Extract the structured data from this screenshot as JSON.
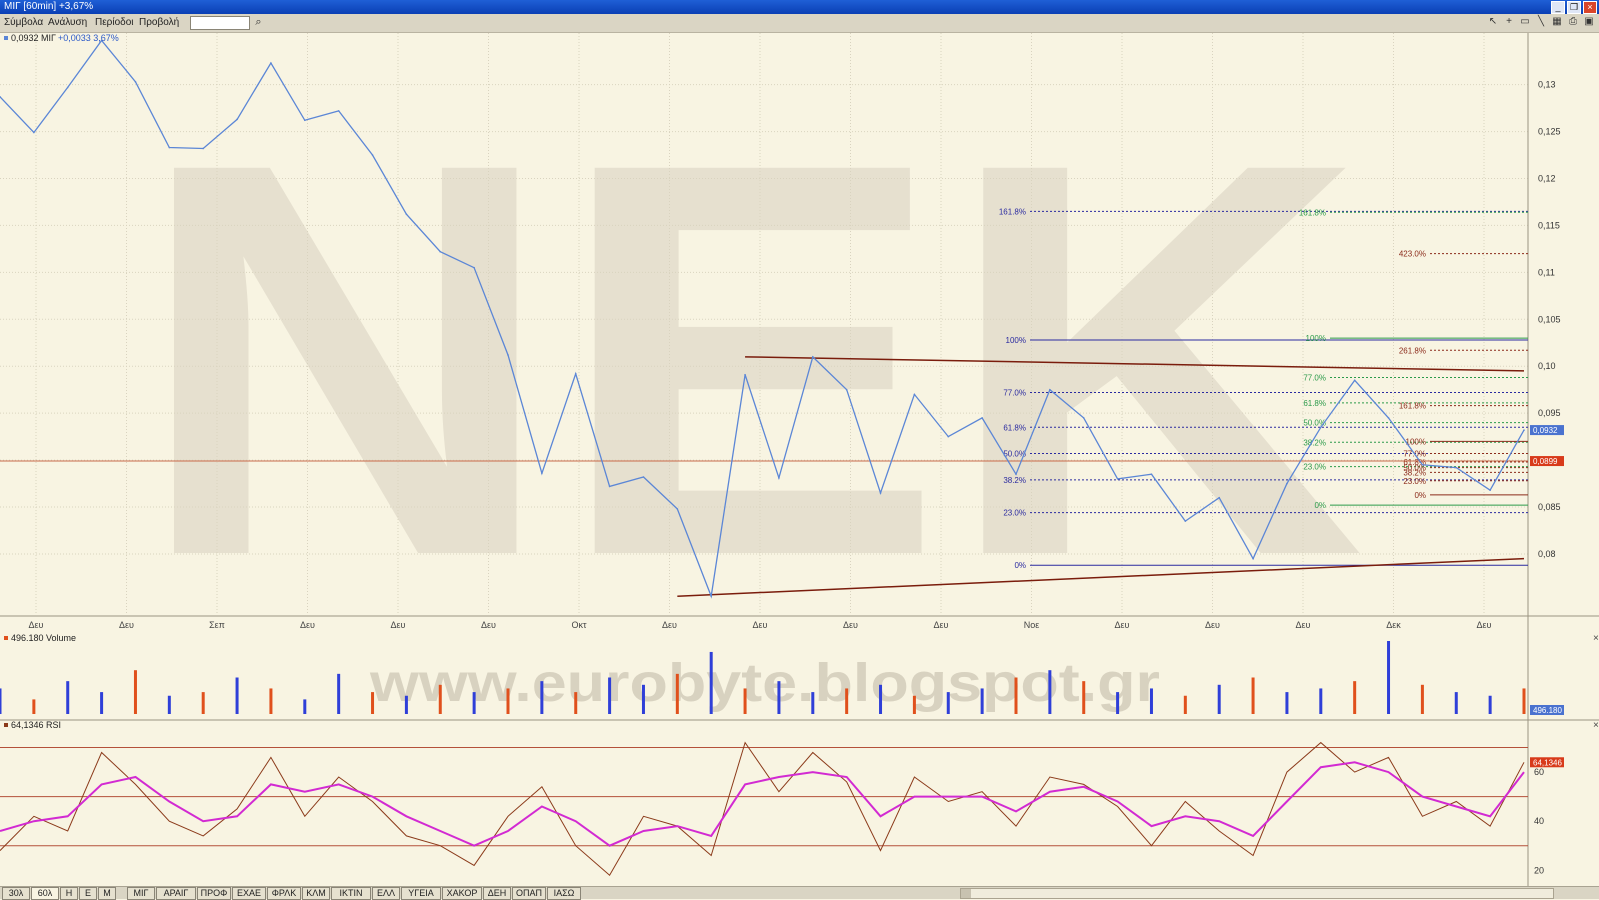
{
  "window": {
    "title": "ΜΙΓ [60min] +3,67%"
  },
  "menu": [
    "Σύμβολα",
    "Ανάλυση",
    "Περίοδοι",
    "Προβολή"
  ],
  "search": {
    "placeholder": ""
  },
  "colors": {
    "background": "#f8f4e2",
    "price_line": "#5b86d6",
    "trend_line": "#7a1c0c",
    "fib_a": "#2a2aa0",
    "fib_b": "#2b9a4a",
    "fib_c": "#8b2a1a",
    "rsi": "#8b3a1a",
    "rsi_ma": "#d22ad2",
    "vol_up": "#2f3fd8",
    "vol_down": "#e0501c"
  },
  "watermarks": {
    "main": "NEK",
    "site": "www.eurobyte.blogspot.gr"
  },
  "chart_data": [
    {
      "type": "line",
      "legend": "0,0932 ΜΙΓ",
      "change": "+0,0033 3,67%",
      "ylim": [
        0.0735,
        0.1355
      ],
      "yticks": [
        "0,13",
        "0,125",
        "0,12",
        "0,115",
        "0,11",
        "0,105",
        "0,10",
        "0,095",
        "0,09",
        "0,085",
        "0,08"
      ],
      "ytick_values": [
        0.13,
        0.125,
        0.12,
        0.115,
        0.11,
        0.105,
        0.1,
        0.095,
        0.09,
        0.085,
        0.08
      ],
      "xticks": [
        "Δευ",
        "Δευ",
        "Σεπ",
        "Δευ",
        "Δευ",
        "Δευ",
        "Οκτ",
        "Δευ",
        "Δευ",
        "Δευ",
        "Δευ",
        "Νοε",
        "Δευ",
        "Δευ",
        "Δευ",
        "Δεκ",
        "Δευ"
      ],
      "x": [
        0,
        4,
        8,
        12,
        16,
        20,
        24,
        28,
        32,
        36,
        40,
        44,
        48,
        52,
        56,
        60,
        64,
        68,
        72,
        76,
        80,
        84,
        88,
        92,
        96,
        100,
        104,
        108,
        112,
        116,
        120,
        124,
        128,
        132,
        136,
        140,
        144,
        148,
        152,
        156,
        160,
        164,
        168,
        172,
        176,
        180
      ],
      "close": [
        0.1287,
        0.1249,
        0.1297,
        0.1347,
        0.1303,
        0.1233,
        0.1232,
        0.1263,
        0.1323,
        0.1262,
        0.1272,
        0.1225,
        0.1162,
        0.1122,
        0.1105,
        0.1012,
        0.0886,
        0.0992,
        0.0872,
        0.0882,
        0.0848,
        0.0755,
        0.0991,
        0.0881,
        0.101,
        0.0975,
        0.0865,
        0.097,
        0.0925,
        0.0945,
        0.0885,
        0.0975,
        0.0945,
        0.088,
        0.0885,
        0.0835,
        0.086,
        0.0795,
        0.0875,
        0.0935,
        0.0985,
        0.0945,
        0.0895,
        0.0892,
        0.0868,
        0.0932
      ],
      "last": "0,0932",
      "ref_level": {
        "value": 0.0899,
        "label": "0,0899"
      },
      "trendlines": [
        {
          "from": [
            80,
            0.0755
          ],
          "to": [
            180,
            0.0795
          ]
        },
        {
          "from": [
            88,
            0.101
          ],
          "to": [
            180,
            0.0995
          ]
        }
      ],
      "fib_sets": [
        {
          "name": "A",
          "levels": [
            "0%",
            "23.0%",
            "38.2%",
            "50.0%",
            "61.8%",
            "77.0%",
            "100%",
            "161.8%"
          ],
          "values": [
            0.0788,
            0.0844,
            0.0879,
            0.0907,
            0.0935,
            0.0972,
            0.1028,
            0.1165
          ]
        },
        {
          "name": "B",
          "levels": [
            "0%",
            "23.0%",
            "38.2%",
            "50.0%",
            "61.8%",
            "77.0%",
            "100%",
            "161.8%"
          ],
          "values": [
            0.0852,
            0.0893,
            0.0919,
            0.094,
            0.0961,
            0.0988,
            0.103,
            0.1164
          ]
        },
        {
          "name": "C",
          "levels": [
            "0%",
            "23.0%",
            "38.2%",
            "50.0%",
            "61.8%",
            "77.0%",
            "100%",
            "161.8%",
            "261.8%",
            "423.0%"
          ],
          "values": [
            0.0863,
            0.0878,
            0.0887,
            0.0892,
            0.0898,
            0.0907,
            0.092,
            0.0958,
            0.1017,
            0.112
          ]
        }
      ]
    },
    {
      "type": "bar",
      "legend": "496.180 Volume",
      "last": "496.180",
      "x": [
        0,
        4,
        8,
        12,
        16,
        20,
        24,
        28,
        32,
        36,
        40,
        44,
        48,
        52,
        56,
        60,
        64,
        68,
        72,
        76,
        80,
        84,
        88,
        92,
        96,
        100,
        104,
        108,
        112,
        116,
        120,
        124,
        128,
        132,
        136,
        140,
        144,
        148,
        152,
        156,
        160,
        164,
        168,
        172,
        176,
        180
      ],
      "values": [
        0.35,
        0.2,
        0.45,
        0.3,
        0.6,
        0.25,
        0.3,
        0.5,
        0.35,
        0.2,
        0.55,
        0.3,
        0.25,
        0.4,
        0.3,
        0.35,
        0.45,
        0.3,
        0.5,
        0.4,
        0.55,
        0.85,
        0.35,
        0.45,
        0.3,
        0.35,
        0.4,
        0.25,
        0.3,
        0.35,
        0.5,
        0.6,
        0.45,
        0.3,
        0.35,
        0.25,
        0.4,
        0.5,
        0.3,
        0.35,
        0.45,
        1.0,
        0.4,
        0.3,
        0.25,
        0.35
      ],
      "up": [
        true,
        false,
        true,
        true,
        false,
        true,
        false,
        true,
        false,
        true,
        true,
        false,
        true,
        false,
        true,
        false,
        true,
        false,
        true,
        true,
        false,
        true,
        false,
        true,
        true,
        false,
        true,
        false,
        true,
        true,
        false,
        true,
        false,
        true,
        true,
        false,
        true,
        false,
        true,
        true,
        false,
        true,
        false,
        true,
        true,
        false
      ]
    },
    {
      "type": "line",
      "legend": "64,1346 RSI",
      "last": "64,1346",
      "ylim": [
        14,
        80
      ],
      "yticks": [
        "60",
        "40",
        "20"
      ],
      "ytick_values": [
        60,
        40,
        20
      ],
      "levels": [
        70,
        50,
        30
      ],
      "x": [
        0,
        4,
        8,
        12,
        16,
        20,
        24,
        28,
        32,
        36,
        40,
        44,
        48,
        52,
        56,
        60,
        64,
        68,
        72,
        76,
        80,
        84,
        88,
        92,
        96,
        100,
        104,
        108,
        112,
        116,
        120,
        124,
        128,
        132,
        136,
        140,
        144,
        148,
        152,
        156,
        160,
        164,
        168,
        172,
        176,
        180
      ],
      "rsi": [
        28,
        42,
        36,
        68,
        55,
        40,
        34,
        45,
        66,
        42,
        58,
        48,
        34,
        30,
        22,
        42,
        54,
        30,
        18,
        42,
        38,
        26,
        72,
        52,
        68,
        56,
        28,
        58,
        48,
        52,
        38,
        58,
        55,
        46,
        30,
        48,
        36,
        26,
        60,
        72,
        60,
        66,
        42,
        48,
        38,
        64
      ],
      "ma": [
        36,
        40,
        42,
        55,
        58,
        48,
        40,
        42,
        55,
        52,
        55,
        50,
        42,
        36,
        30,
        36,
        46,
        40,
        30,
        36,
        38,
        34,
        55,
        58,
        60,
        58,
        42,
        50,
        50,
        50,
        44,
        52,
        54,
        48,
        38,
        42,
        40,
        34,
        48,
        62,
        64,
        60,
        50,
        46,
        42,
        60
      ]
    }
  ],
  "bottom_tabs": [
    "30λ",
    "60λ",
    "Η",
    "Ε",
    "Μ",
    "ΜΙΓ",
    "ΑΡΑΙΓ",
    "ΠΡΟΦ",
    "ΕΧΑΕ",
    "ΦΡΛΚ",
    "ΚΛΜ",
    "ΙΚΤΙΝ",
    "ΕΛΛ",
    "ΥΓΕΙΑ",
    "ΧΑΚΟΡ",
    "ΔΕΗ",
    "ΟΠΑΠ",
    "ΙΑΣΩ"
  ],
  "bottom_tab_active": "60λ"
}
